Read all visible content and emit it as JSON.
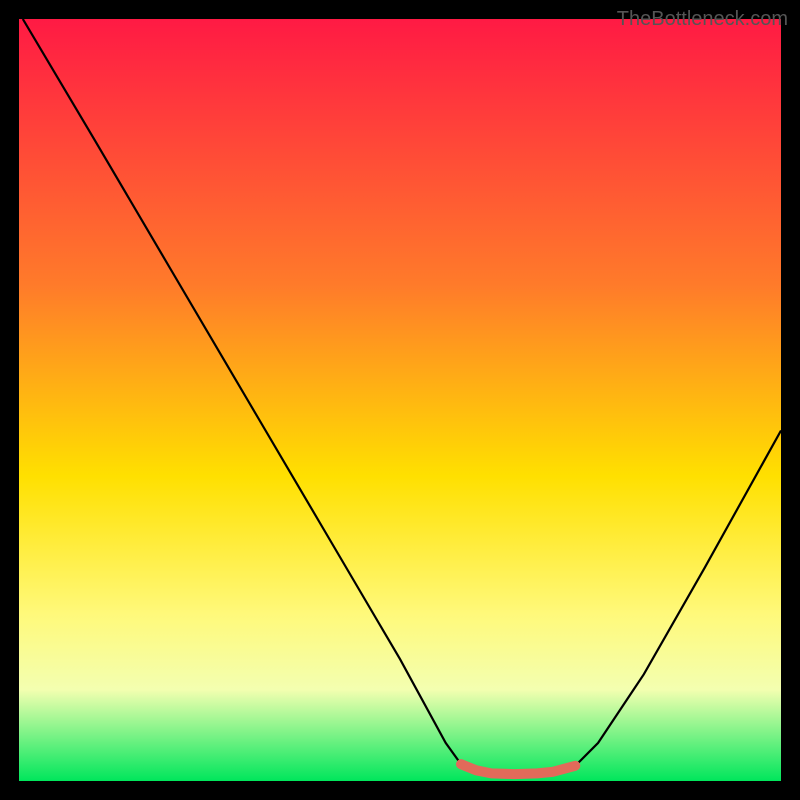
{
  "watermark": "TheBottleneck.com",
  "chart_data": {
    "type": "line",
    "title": "",
    "xlabel": "",
    "ylabel": "",
    "xlim": [
      0,
      100
    ],
    "ylim": [
      0,
      100
    ],
    "gradient_stops": [
      {
        "offset": 0,
        "color": "#ff1a44"
      },
      {
        "offset": 35,
        "color": "#ff7b2a"
      },
      {
        "offset": 60,
        "color": "#ffe000"
      },
      {
        "offset": 78,
        "color": "#fff97a"
      },
      {
        "offset": 88,
        "color": "#f3ffb0"
      },
      {
        "offset": 100,
        "color": "#00e65c"
      }
    ],
    "series": [
      {
        "name": "bottleneck-curve",
        "stroke": "#000000",
        "points": [
          {
            "x": 0.5,
            "y": 100
          },
          {
            "x": 10,
            "y": 84
          },
          {
            "x": 20,
            "y": 67
          },
          {
            "x": 30,
            "y": 50
          },
          {
            "x": 40,
            "y": 33
          },
          {
            "x": 50,
            "y": 16
          },
          {
            "x": 56,
            "y": 5
          },
          {
            "x": 58,
            "y": 2.2
          },
          {
            "x": 60,
            "y": 1.4
          },
          {
            "x": 65,
            "y": 0.9
          },
          {
            "x": 70,
            "y": 1.2
          },
          {
            "x": 73,
            "y": 2.0
          },
          {
            "x": 76,
            "y": 5
          },
          {
            "x": 82,
            "y": 14
          },
          {
            "x": 90,
            "y": 28
          },
          {
            "x": 100,
            "y": 46
          }
        ]
      }
    ],
    "highlight": {
      "color": "#e26a5a",
      "points": [
        {
          "x": 58,
          "y": 2.2
        },
        {
          "x": 60,
          "y": 1.4
        },
        {
          "x": 62,
          "y": 1.0
        },
        {
          "x": 65,
          "y": 0.9
        },
        {
          "x": 68,
          "y": 1.0
        },
        {
          "x": 70,
          "y": 1.2
        },
        {
          "x": 73,
          "y": 2.0
        }
      ]
    }
  }
}
